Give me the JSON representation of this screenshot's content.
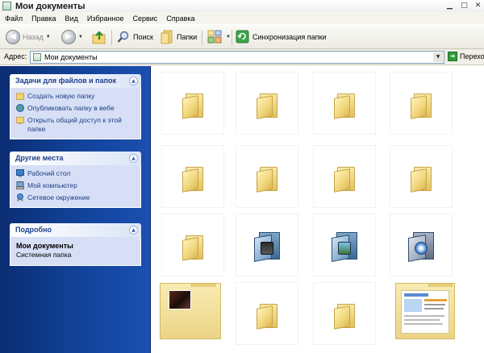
{
  "window": {
    "title": "Мои документы"
  },
  "menu": [
    "Файл",
    "Правка",
    "Вид",
    "Избранное",
    "Сервис",
    "Справка"
  ],
  "toolbar": {
    "back_label": "Назад",
    "search_label": "Поиск",
    "folders_label": "Папки",
    "sync_label": "Синхронизация папки"
  },
  "address": {
    "label": "Адрес:",
    "value": "Мои документы",
    "go_label": "Перехо"
  },
  "panels": {
    "tasks": {
      "title": "Задачи для файлов и папок",
      "items": [
        {
          "label": "Создать новую папку",
          "icon": "new-folder-icon"
        },
        {
          "label": "Опубликовать папку в вебе",
          "icon": "globe-icon"
        },
        {
          "label": "Открыть общий доступ к этой папке",
          "icon": "share-folder-icon"
        }
      ]
    },
    "places": {
      "title": "Другие места",
      "items": [
        {
          "label": "Рабочий стол",
          "icon": "desktop-icon"
        },
        {
          "label": "Мой компьютер",
          "icon": "my-computer-icon"
        },
        {
          "label": "Сетевое окружение",
          "icon": "network-icon"
        }
      ]
    },
    "details": {
      "title": "Подробно",
      "name": "Мои документы",
      "type": "Системная папка"
    }
  },
  "colors": {
    "pane_blue": "#12449c",
    "panel_body": "#d6dff5",
    "panel_title": "#1d3f8f",
    "folder_yellow": "#f0d57a"
  }
}
